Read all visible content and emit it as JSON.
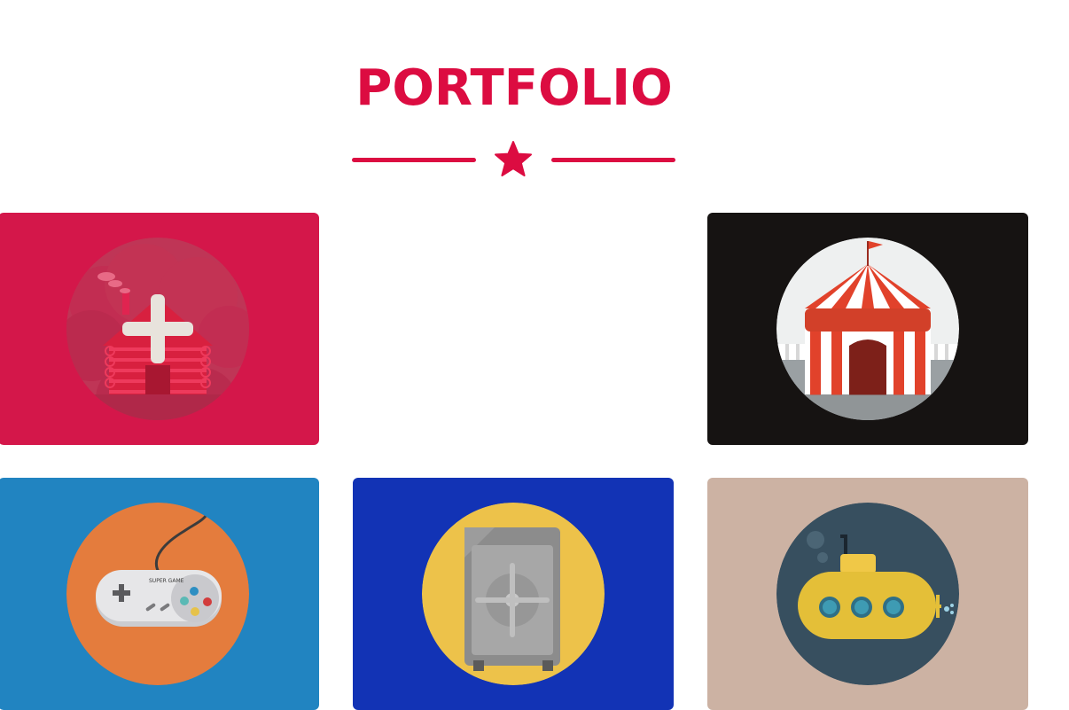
{
  "section": {
    "title": "PORTFOLIO",
    "accent_color": "#dc0c41",
    "divider_icon": "star-icon"
  },
  "portfolio_items": [
    {
      "name": "cabin",
      "icon": "cabin-icon",
      "background": "#d4174a"
    },
    {
      "name": "empty-slot",
      "icon": "",
      "background": "#ffffff"
    },
    {
      "name": "circus",
      "icon": "circus-tent-icon",
      "background": "#161312"
    },
    {
      "name": "game-controller",
      "icon": "game-controller-icon",
      "background": "#2184c1",
      "controller_text": "SUPER GAME"
    },
    {
      "name": "safe",
      "icon": "safe-icon",
      "background": "#1233b5"
    },
    {
      "name": "submarine",
      "icon": "submarine-icon",
      "background": "#ccb2a3"
    }
  ]
}
